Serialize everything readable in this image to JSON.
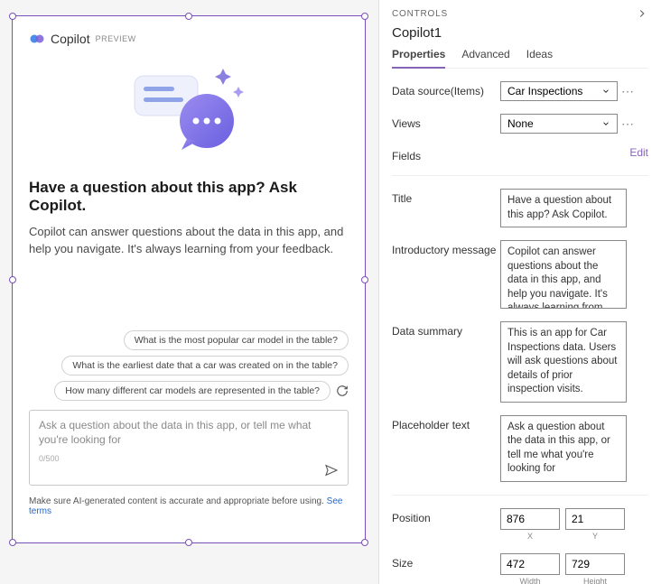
{
  "copilot": {
    "brand_name": "Copilot",
    "preview_badge": "PREVIEW",
    "title": "Have a question about this app? Ask Copilot.",
    "intro": "Copilot can answer questions about the data in this app, and help you navigate. It's always learning from your feedback.",
    "suggestions": [
      "What is the most popular car model in the table?",
      "What is the earliest date that a car was created on in the table?",
      "How many different car models are represented in the table?"
    ],
    "placeholder": "Ask a question about the data in this app, or tell me what you're looking for",
    "char_count": "0/500",
    "footer_text": "Make sure AI-generated content is accurate and appropriate before using. ",
    "footer_link": "See terms"
  },
  "panel": {
    "header": "CONTROLS",
    "control_name": "Copilot1",
    "tabs": [
      "Properties",
      "Advanced",
      "Ideas"
    ],
    "props": {
      "data_source_label": "Data source(Items)",
      "data_source_value": "Car Inspections",
      "views_label": "Views",
      "views_value": "None",
      "fields_label": "Fields",
      "fields_edit": "Edit",
      "title_label": "Title",
      "title_value": "Have a question about this app? Ask Copilot.",
      "intro_label": "Introductory message",
      "intro_value": "Copilot can answer questions about the data in this app, and help you navigate. It's always learning from ",
      "summary_label": "Data summary",
      "summary_value": "This is an app for Car Inspections data. Users will ask questions about details of prior inspection visits.",
      "placeholder_label": "Placeholder text",
      "placeholder_value": "Ask a question about the data in this app, or tell me what you're looking for",
      "position_label": "Position",
      "position_x": "876",
      "position_y": "21",
      "position_x_label": "X",
      "position_y_label": "Y",
      "size_label": "Size",
      "size_w": "472",
      "size_h": "729",
      "size_w_label": "Width",
      "size_h_label": "Height"
    }
  }
}
